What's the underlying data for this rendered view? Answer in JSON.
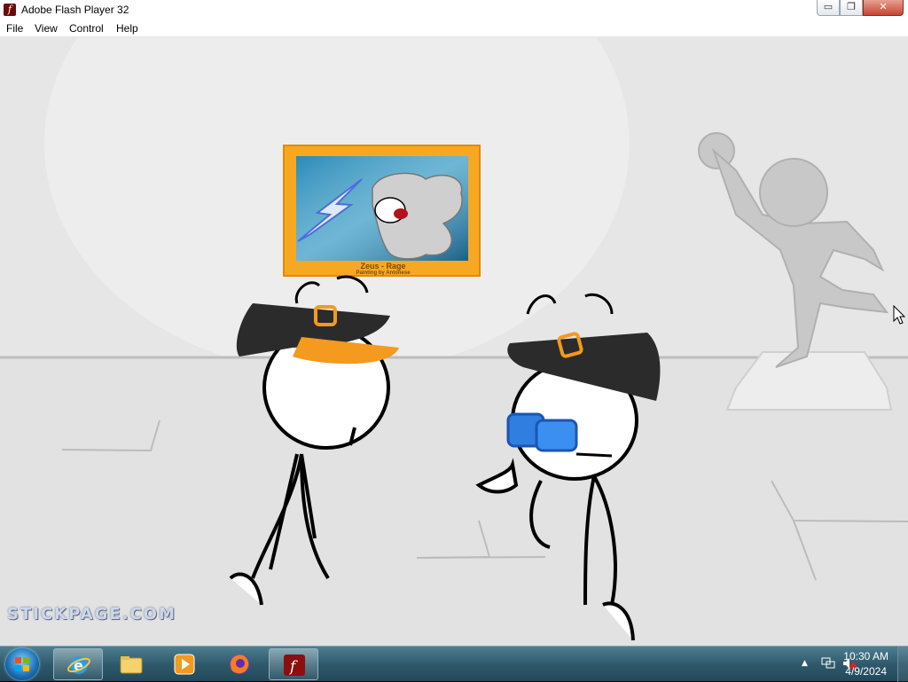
{
  "window": {
    "title": "Adobe Flash Player 32",
    "icon": "flash-icon",
    "controls": {
      "minimize": "▭",
      "maximize": "❐",
      "close": "✕"
    }
  },
  "menu": {
    "items": [
      "File",
      "View",
      "Control",
      "Help"
    ]
  },
  "game": {
    "painting": {
      "title": "Zeus - Rage",
      "subtitle": "Painting by Antonese"
    },
    "watermark": "STICKPAGE.COM"
  },
  "taskbar": {
    "apps": [
      {
        "name": "internet-explorer-icon",
        "active": true
      },
      {
        "name": "file-explorer-icon",
        "active": false
      },
      {
        "name": "media-player-icon",
        "active": false
      },
      {
        "name": "firefox-icon",
        "active": false
      },
      {
        "name": "flash-player-icon",
        "active": true
      }
    ],
    "clock": {
      "time": "10:30 AM",
      "date": "4/9/2024"
    }
  },
  "colors": {
    "stage_bg": "#e6e6e6",
    "frame_orange": "#f7a823",
    "cap_black": "#2b2b2b",
    "logo_orange": "#f39a1f",
    "glasses_blue": "#2e7fe0"
  }
}
